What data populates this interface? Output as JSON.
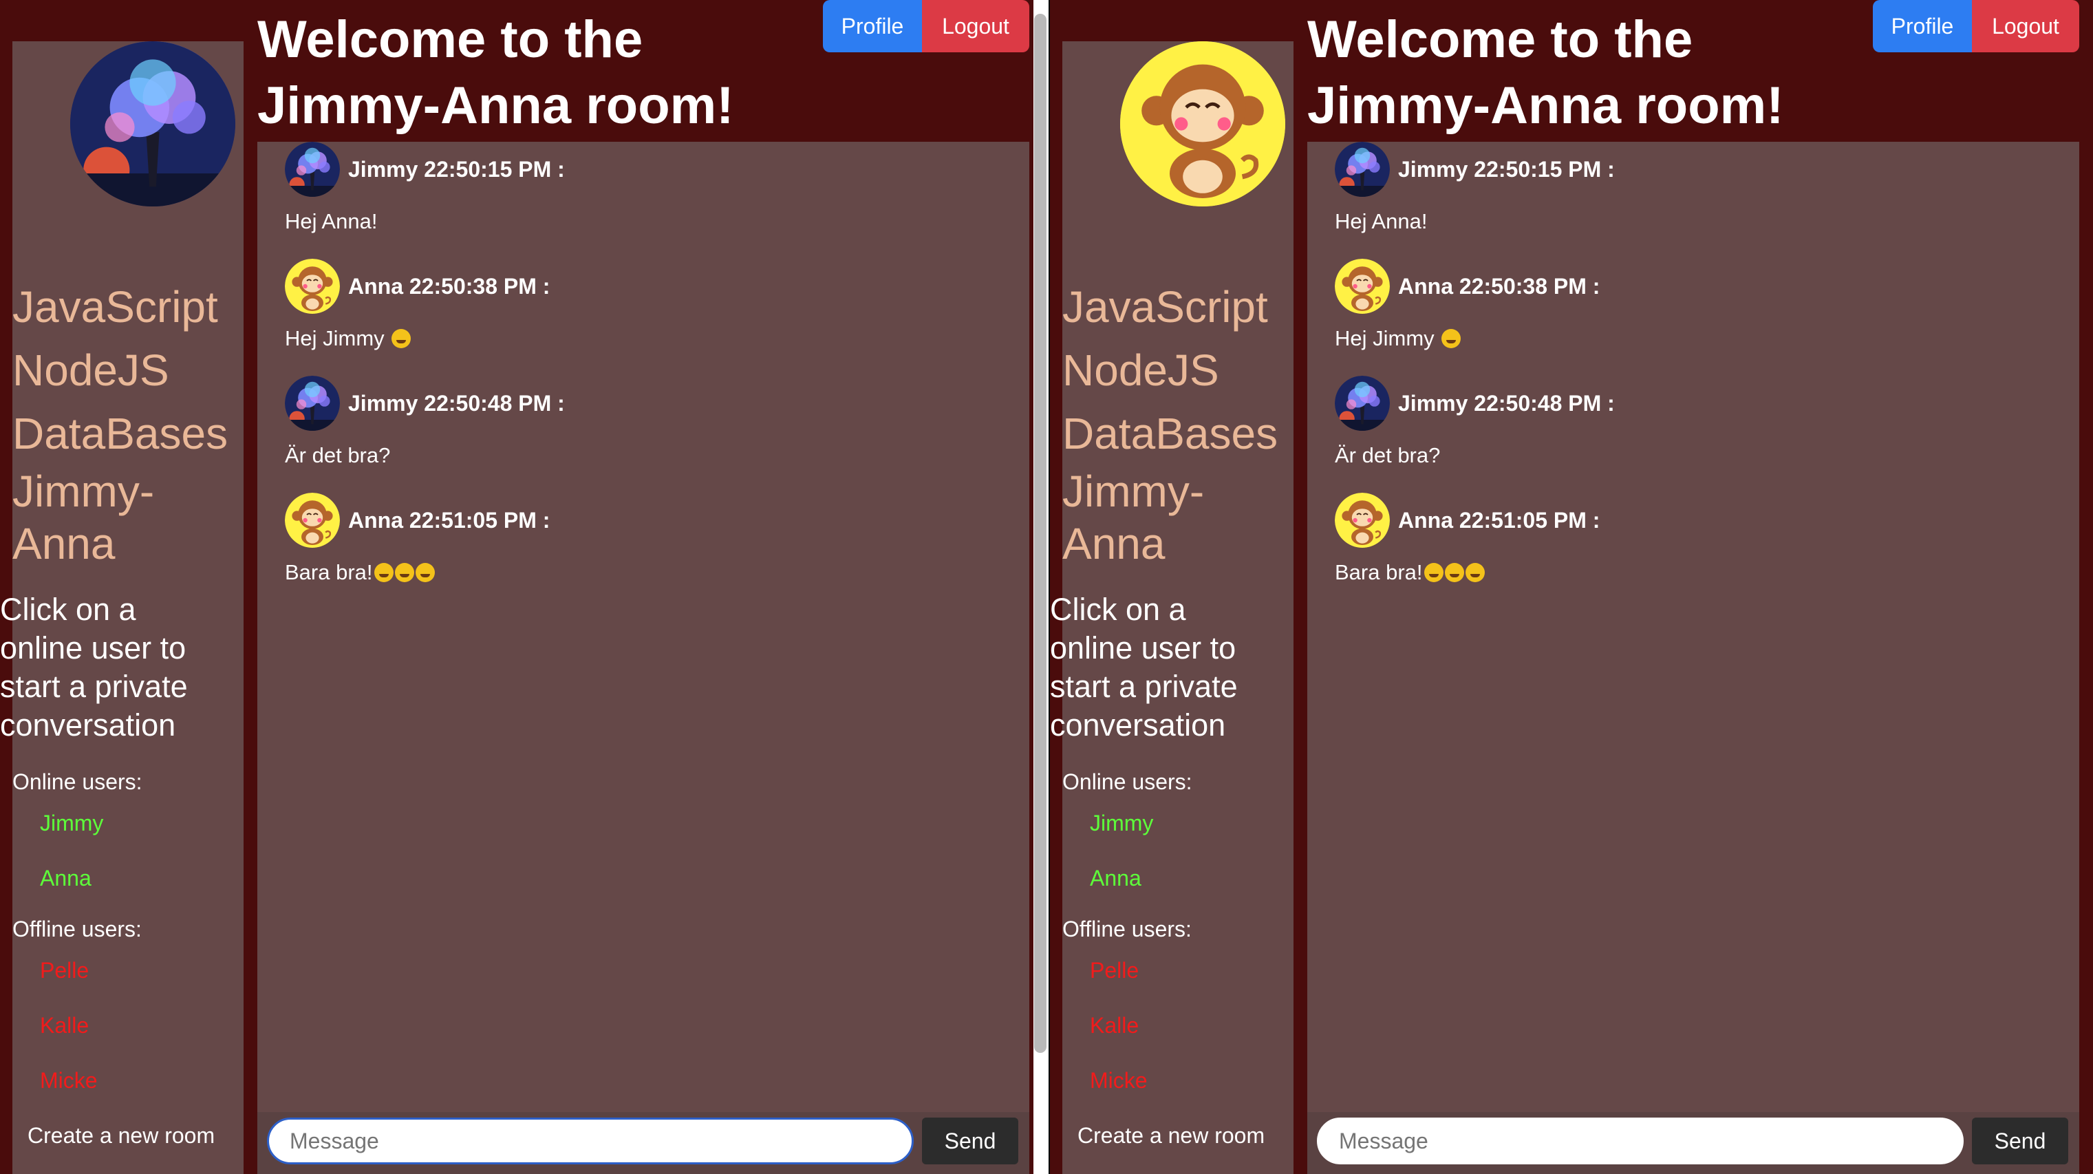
{
  "screen_left": {
    "header": {
      "title_line1": "Welcome to the",
      "title_line2": "Jimmy-Anna room!",
      "profile_label": "Profile",
      "logout_label": "Logout"
    },
    "sidebar": {
      "avatar": "tree-avatar",
      "rooms": [
        "JavaScript",
        "NodeJS",
        "DataBases",
        "Jimmy-",
        "Anna"
      ],
      "hint_lines": [
        "Click on a",
        "online user to",
        "start a private",
        "conversation"
      ],
      "online_label": "Online users:",
      "online_users": [
        "Jimmy",
        "Anna"
      ],
      "offline_label": "Offline users:",
      "offline_users": [
        "Pelle",
        "Kalle",
        "Micke"
      ],
      "create_room_label": "Create a new room"
    },
    "messages": [
      {
        "avatar": "tree-avatar",
        "meta": "Jimmy 22:50:15 PM :",
        "text": "Hej Anna!"
      },
      {
        "avatar": "monkey-avatar",
        "meta": "Anna 22:50:38 PM :",
        "text": "Hej Jimmy"
      },
      {
        "avatar": "tree-avatar",
        "meta": "Jimmy 22:50:48 PM :",
        "text": "Är det bra?"
      },
      {
        "avatar": "monkey-avatar",
        "meta": "Anna 22:51:05 PM :",
        "text": "Bara bra!"
      }
    ],
    "input": {
      "placeholder": "Message",
      "send_label": "Send"
    }
  },
  "screen_right": {
    "header": {
      "title_line1": "Welcome to the",
      "title_line2": "Jimmy-Anna room!",
      "profile_label": "Profile",
      "logout_label": "Logout"
    },
    "sidebar": {
      "avatar": "monkey-avatar",
      "rooms": [
        "JavaScript",
        "NodeJS",
        "DataBases",
        "Jimmy-",
        "Anna"
      ],
      "hint_lines": [
        "Click on a",
        "online user to",
        "start a private",
        "conversation"
      ],
      "online_label": "Online users:",
      "online_users": [
        "Jimmy",
        "Anna"
      ],
      "offline_label": "Offline users:",
      "offline_users": [
        "Pelle",
        "Kalle",
        "Micke"
      ],
      "create_room_label": "Create a new room"
    },
    "messages": [
      {
        "avatar": "tree-avatar",
        "meta": "Jimmy 22:50:15 PM :",
        "text": "Hej Anna!"
      },
      {
        "avatar": "monkey-avatar",
        "meta": "Anna 22:50:38 PM :",
        "text": "Hej Jimmy"
      },
      {
        "avatar": "tree-avatar",
        "meta": "Jimmy 22:50:48 PM :",
        "text": "Är det bra?"
      },
      {
        "avatar": "monkey-avatar",
        "meta": "Anna 22:51:05 PM :",
        "text": "Bara bra!"
      }
    ],
    "input": {
      "placeholder": "Message",
      "send_label": "Send"
    }
  },
  "colors": {
    "header_bg": "#4a0c0c",
    "panel_bg": "#654848",
    "room_link": "#e9b898",
    "online": "#5dff3a",
    "offline": "#f21b1b",
    "profile_btn": "#2d7df2",
    "logout_btn": "#dc3a45"
  }
}
